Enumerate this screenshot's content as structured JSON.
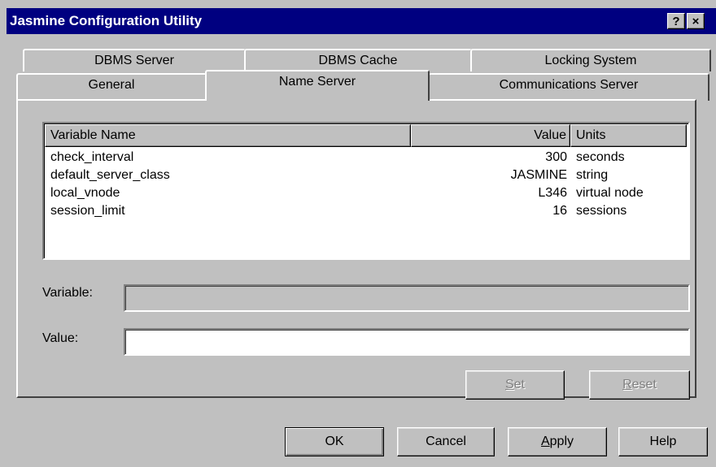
{
  "window": {
    "title": "Jasmine Configuration Utility",
    "help_glyph": "?",
    "close_glyph": "×"
  },
  "tabs": {
    "back_row": [
      "DBMS Server",
      "DBMS Cache",
      "Locking System"
    ],
    "front_row": [
      "General",
      "Name Server",
      "Communications Server"
    ],
    "active": "Name Server"
  },
  "table": {
    "columns": [
      "Variable Name",
      "Value",
      "Units"
    ],
    "rows": [
      {
        "name": "check_interval",
        "value": "300",
        "units": "seconds"
      },
      {
        "name": "default_server_class",
        "value": "JASMINE",
        "units": "string"
      },
      {
        "name": "local_vnode",
        "value": "L346",
        "units": "virtual node"
      },
      {
        "name": "session_limit",
        "value": "16",
        "units": "sessions"
      }
    ]
  },
  "form": {
    "variable_label": "Variable:",
    "variable_value": "",
    "value_label": "Value:",
    "value_value": ""
  },
  "panel_buttons": {
    "set_mnemonic": "S",
    "set_rest": "et",
    "reset_mnemonic": "R",
    "reset_rest": "eset"
  },
  "dialog_buttons": {
    "ok": "OK",
    "cancel": "Cancel",
    "apply_mnemonic": "A",
    "apply_rest": "pply",
    "help": "Help"
  },
  "colors": {
    "titlebar": "#000080",
    "face": "#c0c0c0"
  }
}
